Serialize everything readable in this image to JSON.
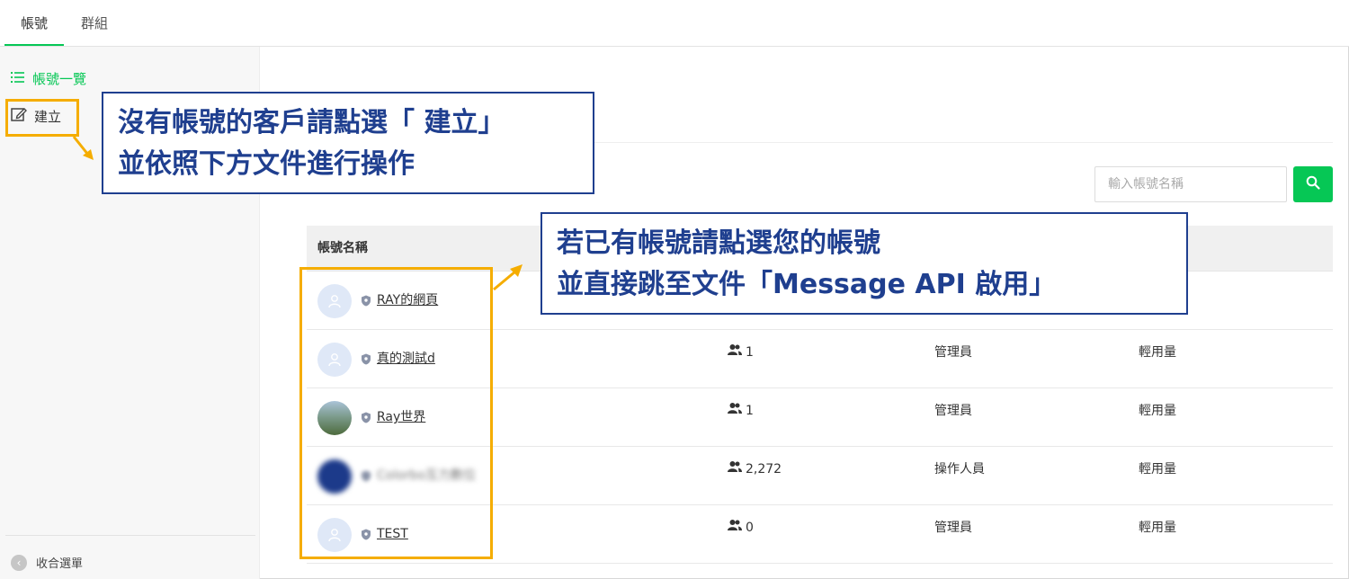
{
  "tabs": [
    {
      "label": "帳號"
    },
    {
      "label": "群組"
    }
  ],
  "sidebar": {
    "items": [
      {
        "label": "帳號一覽",
        "icon": "list-icon"
      },
      {
        "label": "建立",
        "icon": "edit-icon"
      }
    ],
    "collapse_label": "收合選單"
  },
  "search": {
    "placeholder": "輸入帳號名稱"
  },
  "table": {
    "header": "帳號名稱",
    "rows": [
      {
        "name": "RAY的網頁",
        "members": "",
        "role": "",
        "plan": ""
      },
      {
        "name": "真的測試d",
        "members": "1",
        "role": "管理員",
        "plan": "輕用量"
      },
      {
        "name": "Ray世界",
        "members": "1",
        "role": "管理員",
        "plan": "輕用量"
      },
      {
        "name": "Colorbo互力數位",
        "members": "2,272",
        "role": "操作人員",
        "plan": "輕用量"
      },
      {
        "name": "TEST",
        "members": "0",
        "role": "管理員",
        "plan": "輕用量"
      }
    ]
  },
  "callouts": {
    "create": [
      "沒有帳號的客戶請點選「 建立」",
      "並依照下方文件進行操作"
    ],
    "existing": [
      "若已有帳號請點選您的帳號",
      "並直接跳至文件「Message API 啟用」"
    ]
  },
  "colors": {
    "accent": "#06c755",
    "highlight": "#f5ad00",
    "callout": "#1f3f8f"
  }
}
